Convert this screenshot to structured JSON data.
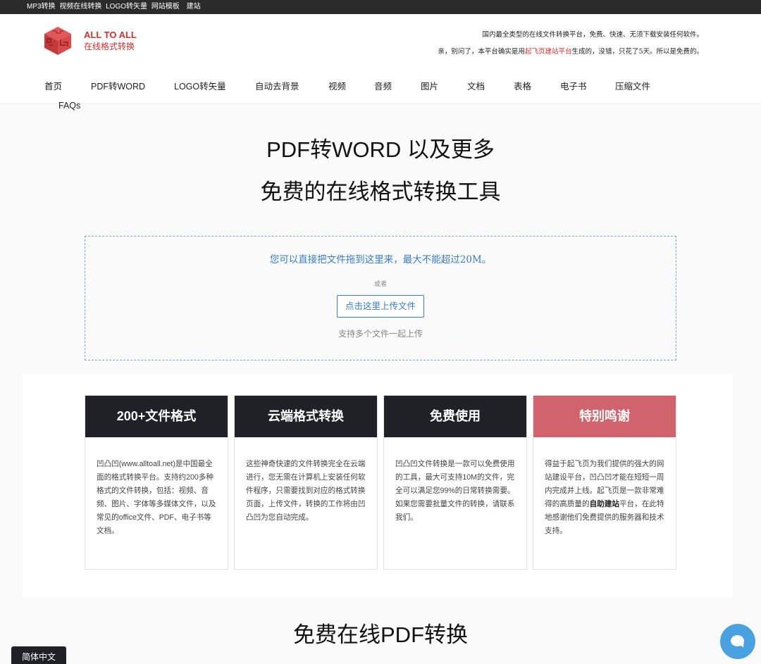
{
  "topbar": {
    "links": [
      "MP3转换",
      "视频在线转换",
      "LOGO转矢量",
      "网站模板",
      "建站"
    ]
  },
  "brand": {
    "name_en": "ALL TO ALL",
    "name_cn": "在线格式转换"
  },
  "tagline": {
    "line1": "国内最全类型的在线文件转换平台，免费、快速、无须下载安装任何软件。",
    "line2_prefix": "亲，别问了，本平台确实是用",
    "line2_link": "起飞页建站平台",
    "line2_suffix": "生成的，没错，只花了5天。所以是免费的。"
  },
  "nav": {
    "items": [
      "首页",
      "PDF转WORD",
      "LOGO转矢量",
      "自动去背景",
      "视频",
      "音频",
      "图片",
      "文档",
      "表格",
      "电子书",
      "压缩文件",
      "FAQs"
    ]
  },
  "hero": {
    "title1": "PDF转WORD 以及更多",
    "title2": "免费的在线格式转换工具"
  },
  "dropzone": {
    "hint": "您可以直接把文件拖到这里来，最大不能超过20M。",
    "or": "或者",
    "button": "点击这里上传文件",
    "multi": "支持多个文件一起上传"
  },
  "features": [
    {
      "title": "200+文件格式",
      "body": "凹凸凹(www.alltoall.net)是中国最全面的格式转换平台。支持约200多种格式的文件转换，包括：视频、音频、图片、字体等多媒体文件，以及常见的office文件、PDF、电子书等文档。"
    },
    {
      "title": "云端格式转换",
      "body": "这些神奇快速的文件转换完全在云端进行，您无需在计算机上安装任何软件程序，只需要找到对应的格式转换页面，上传文件，转换的工作将由凹凸凹为您自动完成。"
    },
    {
      "title": "免费使用",
      "body": "凹凸凹文件转换是一款可以免费使用的工具，最大可支持10M的文件，完全可以满足您99%的日常转换需要。如果您需要批量文件的转换，请联系我们。"
    },
    {
      "title": "特别鸣谢",
      "body_prefix": "得益于起飞页为我们提供的强大的网站建设平台，凹凸凹才能在短短一周内完成并上线。起飞页是一款非常难得的高质量的",
      "body_bold": "自助建站",
      "body_suffix": "平台，在此特地感谢他们免费提供的服务器和技术支持。"
    }
  ],
  "section2": {
    "title": "免费在线PDF转换"
  },
  "lang": {
    "label": "简体中文"
  },
  "colors": {
    "brand_red": "#d0312d",
    "link_blue": "#3a7cc2",
    "card_dark": "#1f2127",
    "card_pink": "#d0636b",
    "chat_blue": "#4aa1e0"
  }
}
